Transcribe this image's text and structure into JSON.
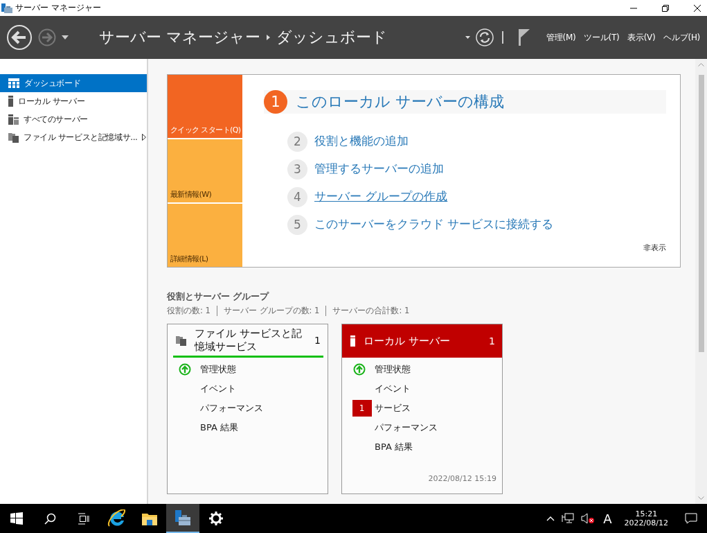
{
  "window": {
    "title": "サーバー マネージャー"
  },
  "header": {
    "breadcrumb": [
      "サーバー マネージャー",
      "ダッシュボード"
    ],
    "menus": [
      "管理(M)",
      "ツール(T)",
      "表示(V)",
      "ヘルプ(H)"
    ]
  },
  "sidebar": {
    "items": [
      {
        "label": "ダッシュボード",
        "kind": "dashboard",
        "selected": true,
        "has_submenu": false
      },
      {
        "label": "ローカル サーバー",
        "kind": "server",
        "selected": false,
        "has_submenu": false
      },
      {
        "label": "すべてのサーバー",
        "kind": "servers",
        "selected": false,
        "has_submenu": false
      },
      {
        "label": "ファイル サービスと記憶域サ...",
        "kind": "files",
        "selected": false,
        "has_submenu": true
      }
    ]
  },
  "quick_start": {
    "tabs": [
      {
        "label": "クイック スタート(Q)",
        "selected": true
      },
      {
        "label": "最新情報(W)",
        "selected": false
      },
      {
        "label": "詳細情報(L)",
        "selected": false
      }
    ],
    "steps": [
      {
        "number": "1",
        "label": "このローカル サーバーの構成",
        "kind": "main",
        "hovered": false
      },
      {
        "number": "2",
        "label": "役割と機能の追加",
        "kind": "sub",
        "hovered": false
      },
      {
        "number": "3",
        "label": "管理するサーバーの追加",
        "kind": "sub",
        "hovered": false
      },
      {
        "number": "4",
        "label": "サーバー グループの作成",
        "kind": "sub",
        "hovered": true
      },
      {
        "number": "5",
        "label": "このサーバーをクラウド サービスに接続する",
        "kind": "sub",
        "hovered": false
      }
    ],
    "hide_link": "非表示"
  },
  "roles": {
    "title": "役割とサーバー グループ",
    "summary": [
      "役割の数: 1",
      "サーバー グループの数: 1",
      "サーバーの合計数: 1"
    ],
    "tiles": [
      {
        "title": "ファイル サービスと記憶域サービス",
        "count": "1",
        "kind": "files",
        "alert": false,
        "rows": [
          {
            "label": "管理状態",
            "kind": "status"
          },
          {
            "label": "イベント",
            "kind": "plain"
          },
          {
            "label": "パフォーマンス",
            "kind": "plain"
          },
          {
            "label": "BPA 結果",
            "kind": "plain"
          }
        ]
      },
      {
        "title": "ローカル サーバー",
        "count": "1",
        "kind": "server",
        "alert": true,
        "rows": [
          {
            "label": "管理状態",
            "kind": "status"
          },
          {
            "label": "イベント",
            "kind": "plain"
          },
          {
            "label": "サービス",
            "kind": "alert",
            "badge": "1"
          },
          {
            "label": "パフォーマンス",
            "kind": "plain"
          },
          {
            "label": "BPA 結果",
            "kind": "plain"
          }
        ],
        "timestamp": "2022/08/12 15:19"
      }
    ]
  },
  "taskbar": {
    "apps": [
      {
        "kind": "start",
        "active": false
      },
      {
        "kind": "search",
        "active": false
      },
      {
        "kind": "taskview",
        "active": false
      },
      {
        "kind": "ie",
        "active": false
      },
      {
        "kind": "explorer",
        "active": false
      },
      {
        "kind": "servermanager",
        "active": true
      },
      {
        "kind": "settings",
        "active": false
      }
    ],
    "ime": "A",
    "time": "15:21",
    "date": "2022/08/12"
  }
}
